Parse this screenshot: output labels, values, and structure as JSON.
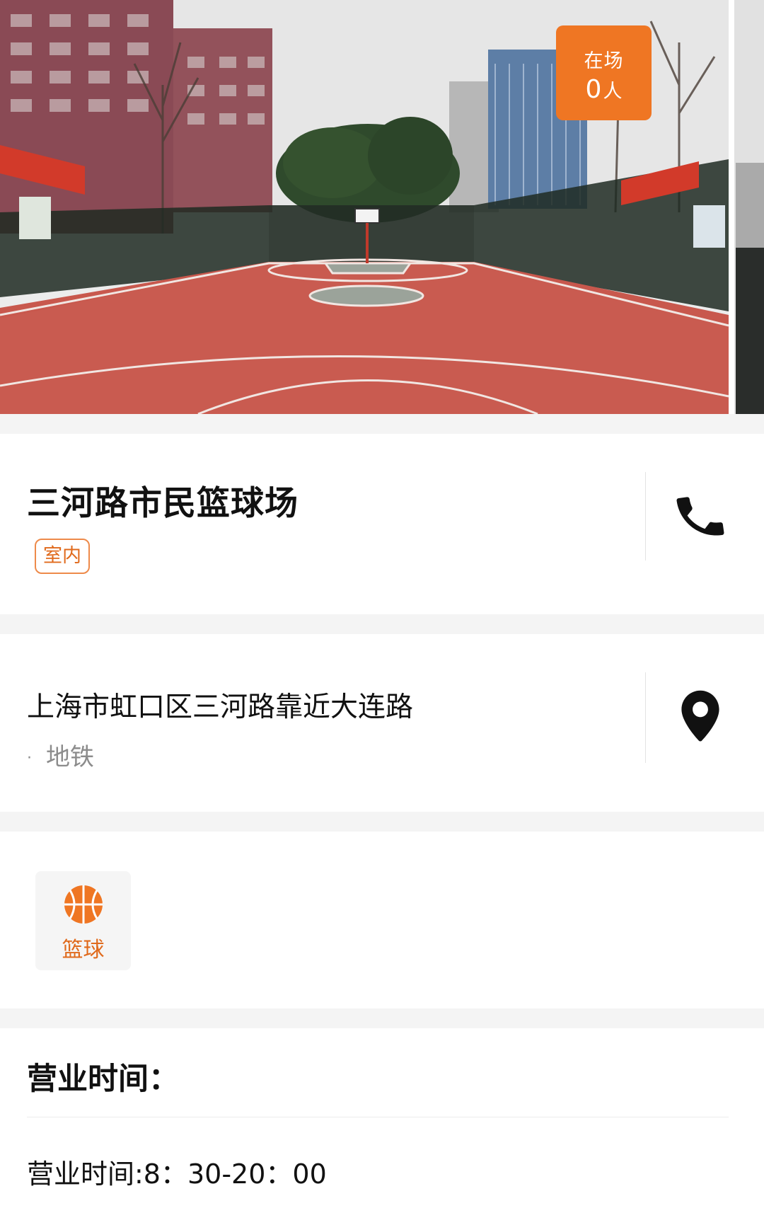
{
  "hero": {
    "badge_label": "在场",
    "badge_count": "0",
    "badge_unit": "人",
    "badge_color": "#ef7623"
  },
  "venue": {
    "name": "三河路市民篮球场",
    "tag": "室内",
    "phone_icon": "phone-icon"
  },
  "location": {
    "address": "上海市虹口区三河路靠近大连路",
    "transit": "地铁",
    "map_icon": "map-pin-icon"
  },
  "sports": [
    {
      "name": "篮球",
      "icon": "basketball-icon",
      "color": "#ef7623"
    }
  ],
  "hours": {
    "heading": "营业时间：",
    "text": "营业时间:8：30-20：00"
  }
}
